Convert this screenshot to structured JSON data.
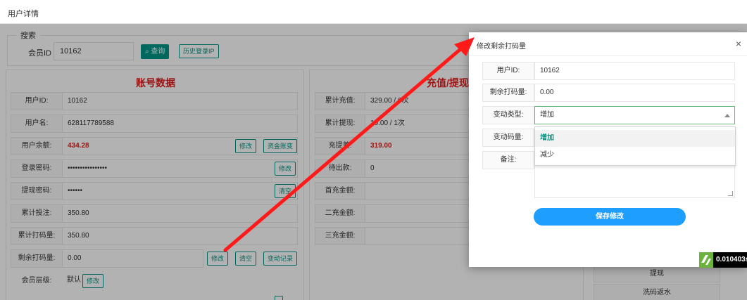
{
  "window": {
    "title": "用户详情"
  },
  "search": {
    "legend": "搜索",
    "member_label": "会员ID",
    "member_value": "10162",
    "query_button": "查询",
    "history_button": "历史登录IP"
  },
  "account": {
    "title": "账号数据",
    "rows": [
      {
        "label": "用户ID:",
        "value": "10162"
      },
      {
        "label": "用户名:",
        "value": "628117789588"
      },
      {
        "label": "用户余额:",
        "value": "434.28"
      },
      {
        "label": "登录密码:",
        "value": "••••••••••••••••"
      },
      {
        "label": "提现密码:",
        "value": "••••••"
      },
      {
        "label": "累计投注:",
        "value": "350.80"
      },
      {
        "label": "累计打码量:",
        "value": "350.80"
      },
      {
        "label": "剩余打码量:",
        "value": "0.00"
      },
      {
        "label": "会员层级:",
        "value": "默认"
      }
    ],
    "btn_modify": "修改",
    "btn_funds": "资金账变",
    "btn_clear": "清空",
    "btn_history": "变动记录"
  },
  "recharge": {
    "title": "充值/提现",
    "rows": [
      {
        "label": "累计充值:",
        "value": "329.00 / 6次"
      },
      {
        "label": "累计提现:",
        "value": "10.00 / 1次"
      },
      {
        "label": "充提差:",
        "value": "319.00"
      },
      {
        "label": "待出款:",
        "value": "0"
      },
      {
        "label": "首充金额:",
        "value": ""
      },
      {
        "label": "二充金额:",
        "value": ""
      },
      {
        "label": "三充金额:",
        "value": ""
      }
    ]
  },
  "side": {
    "withdraw": "提现",
    "rebate": "洗码返水"
  },
  "modal": {
    "title": "修改剩余打码量",
    "close": "×",
    "user_id_label": "用户ID:",
    "user_id_value": "10162",
    "remaining_label": "剩余打码量:",
    "remaining_value": "0.00",
    "change_type_label": "变动类型:",
    "change_type_value": "增加",
    "change_amount_label": "变动码量:",
    "note_label": "备注:",
    "options": [
      "增加",
      "减少"
    ],
    "save_button": "保存修改"
  },
  "timer": {
    "value": "0.010403s"
  },
  "colors": {
    "accent": "#009688",
    "danger": "#e02020",
    "primary": "#1e9fff",
    "arrow": "#ff1a1a"
  }
}
